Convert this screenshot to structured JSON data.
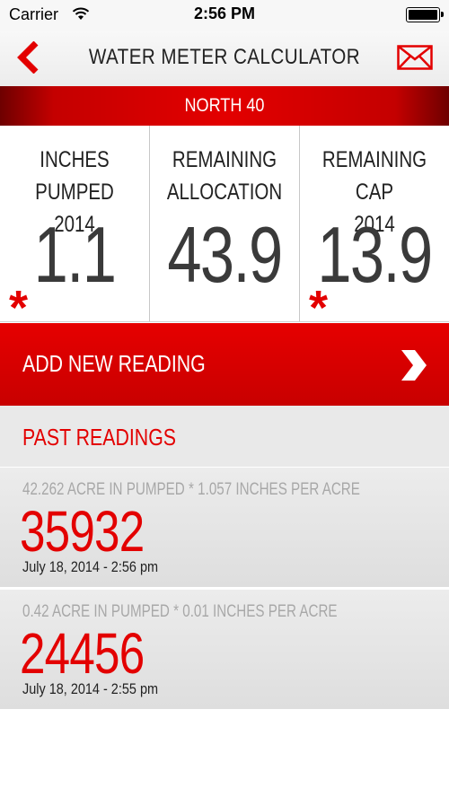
{
  "status_bar": {
    "carrier": "Carrier",
    "time": "2:56 PM"
  },
  "nav": {
    "title": "WATER METER CALCULATOR",
    "back_icon": "back-arrow-icon",
    "mail_icon": "mail-icon"
  },
  "section": {
    "name": "NORTH 40"
  },
  "stats": [
    {
      "label": "INCHES PUMPED\n2014",
      "value": "1.1",
      "flagged": true
    },
    {
      "label": "REMAINING\nALLOCATION",
      "value": "43.9",
      "flagged": false
    },
    {
      "label": "REMAINING CAP\n2014",
      "value": "13.9",
      "flagged": true
    }
  ],
  "add_reading": {
    "label": "ADD NEW READING",
    "icon": "chevron-right-icon"
  },
  "past_readings": {
    "header": "PAST READINGS",
    "items": [
      {
        "formula": "42.262 ACRE IN PUMPED * 1.057 INCHES PER ACRE",
        "value": "35932",
        "date": "July 18, 2014 - 2:56 pm"
      },
      {
        "formula": "0.42 ACRE IN PUMPED * 0.01 INCHES PER ACRE",
        "value": "24456",
        "date": "July 18, 2014 - 2:55 pm"
      }
    ]
  },
  "colors": {
    "accent": "#e30000",
    "dark_accent": "#6e0000",
    "background": "#ffffff",
    "list_background": "#e6e6e6"
  },
  "asterisk": "*"
}
